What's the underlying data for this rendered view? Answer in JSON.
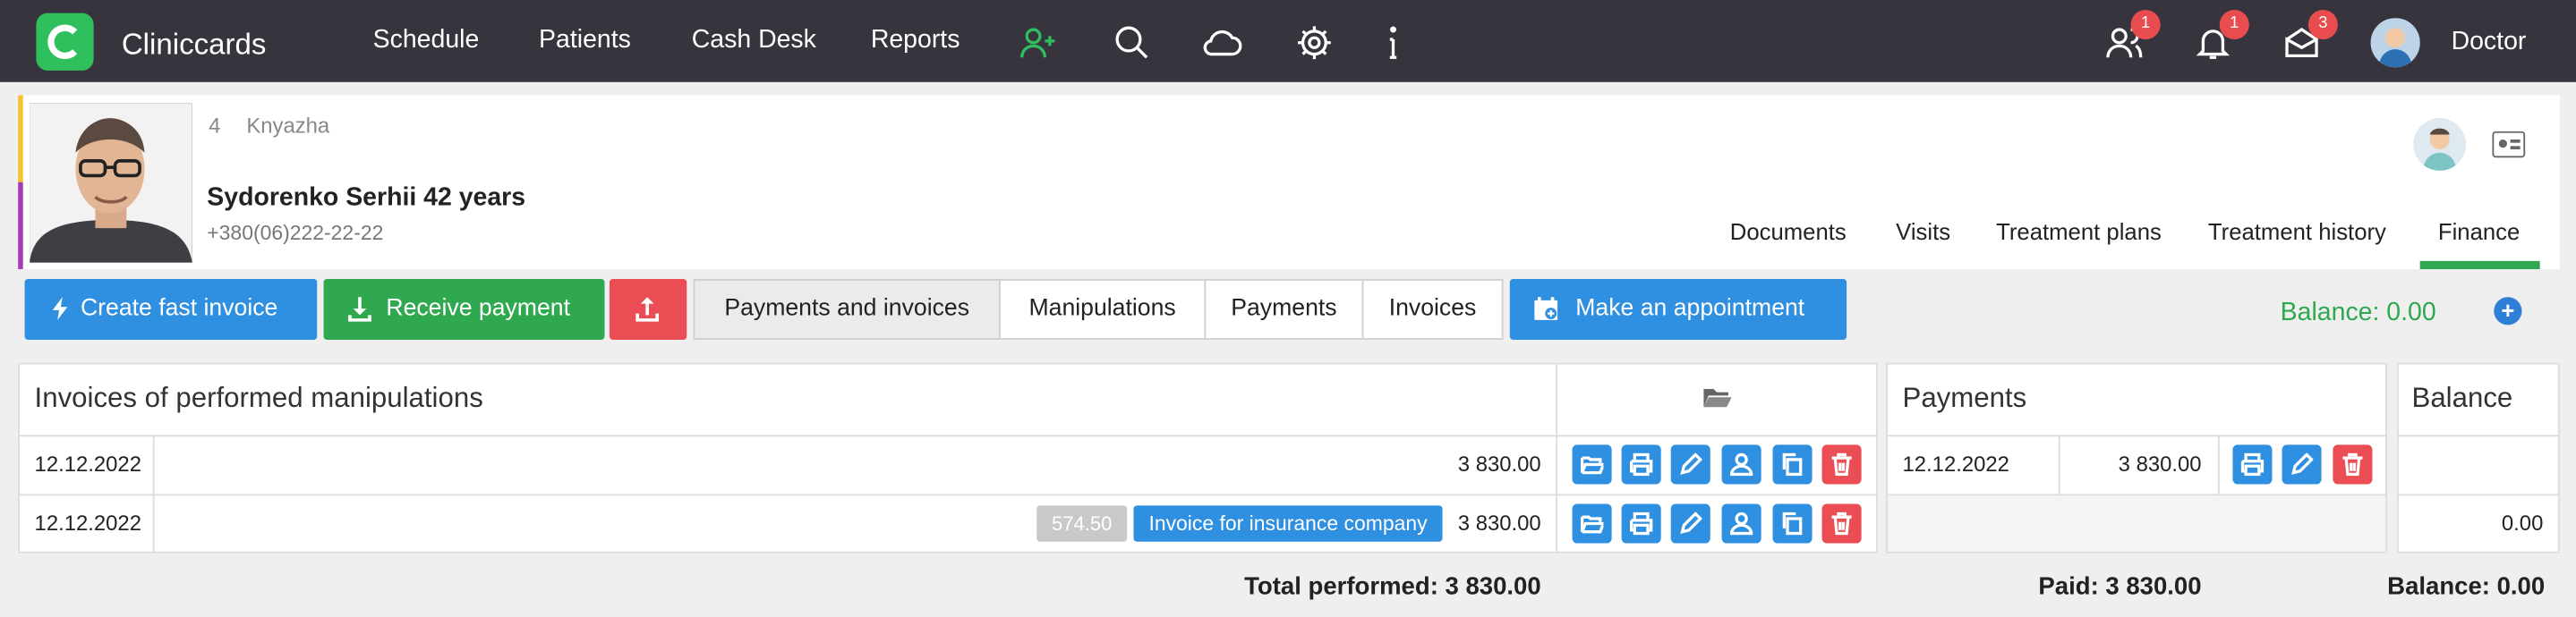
{
  "app": {
    "name": "Cliniccards"
  },
  "nav": [
    "Schedule",
    "Patients",
    "Cash Desk",
    "Reports"
  ],
  "notifications": {
    "users": "1",
    "bell": "1",
    "mail": "3"
  },
  "user": {
    "label": "Doctor"
  },
  "patient": {
    "number": "4",
    "nickname": "Knyazha",
    "name": "Sydorenko Serhii  42 years",
    "phone": "+380(06)222-22-22"
  },
  "patient_tabs": [
    "Documents",
    "Visits",
    "Treatment plans",
    "Treatment history",
    "Finance"
  ],
  "active_tab": "Finance",
  "actions": {
    "fast_invoice": "Create fast invoice",
    "receive_payment": "Receive payment",
    "make_appointment": "Make an appointment"
  },
  "segments": [
    "Payments and invoices",
    "Manipulations",
    "Payments",
    "Invoices"
  ],
  "balance_top": "Balance: 0.00",
  "invoices": {
    "title": "Invoices of performed manipulations",
    "rows": [
      {
        "date": "12.12.2022",
        "amount": "3 830.00"
      },
      {
        "date": "12.12.2022",
        "amount": "3 830.00",
        "discount": "574.50",
        "insurance": "Invoice for insurance company"
      }
    ]
  },
  "payments": {
    "title": "Payments",
    "rows": [
      {
        "date": "12.12.2022",
        "amount": "3 830.00"
      }
    ]
  },
  "balance": {
    "title": "Balance",
    "rows": [
      "",
      "0.00"
    ]
  },
  "totals": {
    "performed": "Total performed: 3 830.00",
    "paid": "Paid: 3 830.00",
    "balance": "Balance: 0.00"
  },
  "colors": {
    "topbar": "#37343e",
    "green": "#2fa84f",
    "blue": "#2f8fe0",
    "red": "#ea4d53"
  }
}
